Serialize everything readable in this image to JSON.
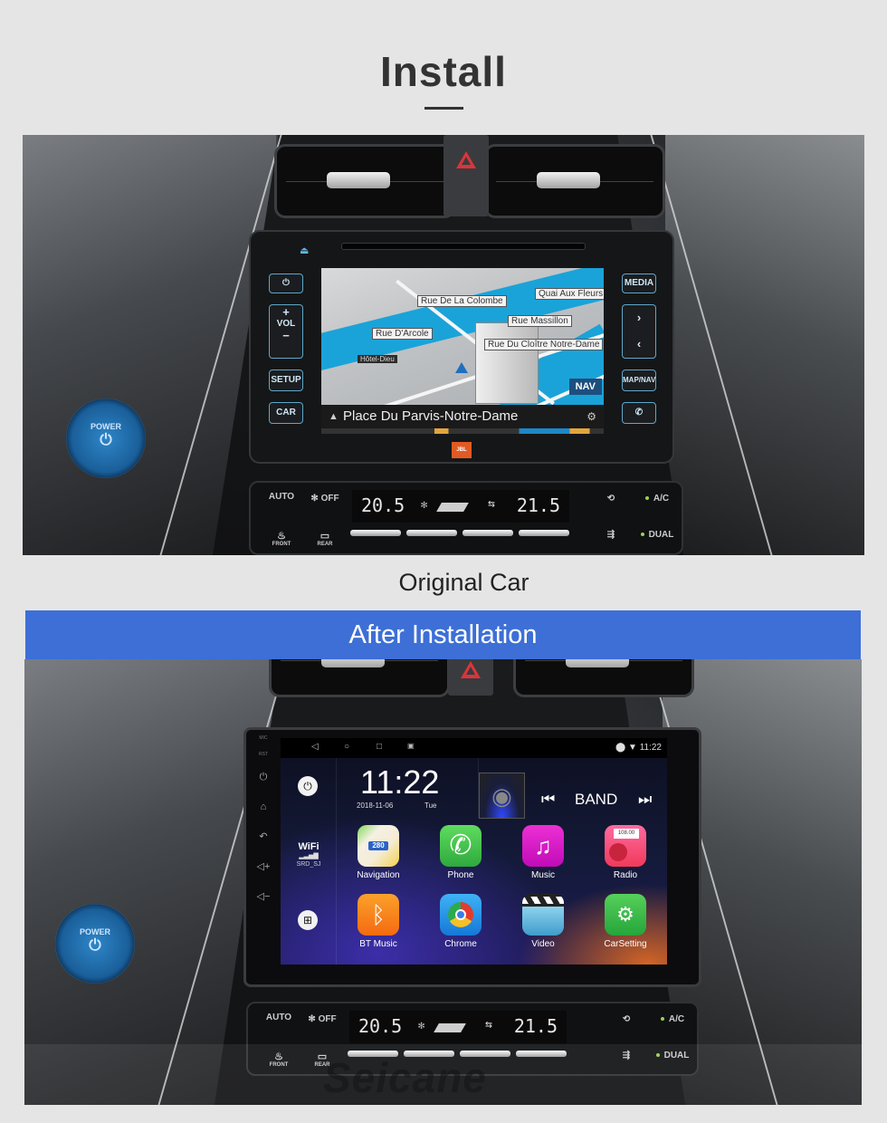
{
  "page": {
    "title": "Install",
    "caption_original": "Original Car",
    "banner_after": "After Installation",
    "banner_color": "#3d6fd6",
    "watermark": "Seicane"
  },
  "original_car": {
    "power_button": {
      "label": "POWER",
      "icon": "power-icon"
    },
    "oem_buttons_left": [
      "VOL",
      "SETUP",
      "CAR"
    ],
    "oem_buttons_right": [
      "MEDIA",
      "MAP/NAV"
    ],
    "vol_plus": "+",
    "vol_minus": "−",
    "map": {
      "labels": [
        "Rue De La Colombe",
        "Quai Aux Fleurs",
        "Rue Massillon",
        "Rue D'Arcole",
        "Rue Du Cloître Notre-Dame",
        "Hôtel-Dieu"
      ],
      "nav_button": "NAV",
      "current_street": "Place Du Parvis-Notre-Dame"
    },
    "brand_badge": "JBL"
  },
  "climate": {
    "auto_label": "AUTO",
    "fan_off_label": "OFF",
    "front_label": "FRONT",
    "rear_label": "REAR",
    "temp_left": "20.5",
    "temp_right": "21.5",
    "ac_label": "A/C",
    "dual_label": "DUAL"
  },
  "head_unit": {
    "side_labels": {
      "mic": "MIC",
      "rst": "RST"
    },
    "status_time": "11:22",
    "clock_time": "11:22",
    "date": "2018-11-06",
    "day": "Tue",
    "wifi": {
      "label": "WiFi",
      "ssid": "SRD_SJ"
    },
    "band_label": "BAND",
    "apps": [
      {
        "label": "Navigation",
        "icon": "maps-icon",
        "color": "#f2d24a"
      },
      {
        "label": "Phone",
        "icon": "phone-icon",
        "color": "#3bc24b"
      },
      {
        "label": "Music",
        "icon": "music-note-icon",
        "color": "#d613c9"
      },
      {
        "label": "Radio",
        "icon": "radio-icon",
        "color": "#f0507a"
      },
      {
        "label": "BT Music",
        "icon": "bluetooth-headphones-icon",
        "color": "#f7871c"
      },
      {
        "label": "Chrome",
        "icon": "chrome-icon",
        "color": "#2193e8"
      },
      {
        "label": "Video",
        "icon": "clapperboard-icon",
        "color": "#5fb6db"
      },
      {
        "label": "CarSetting",
        "icon": "car-settings-icon",
        "color": "#2fb94a"
      }
    ],
    "radio_freq_text": "108.00",
    "nav_shield": "280"
  }
}
